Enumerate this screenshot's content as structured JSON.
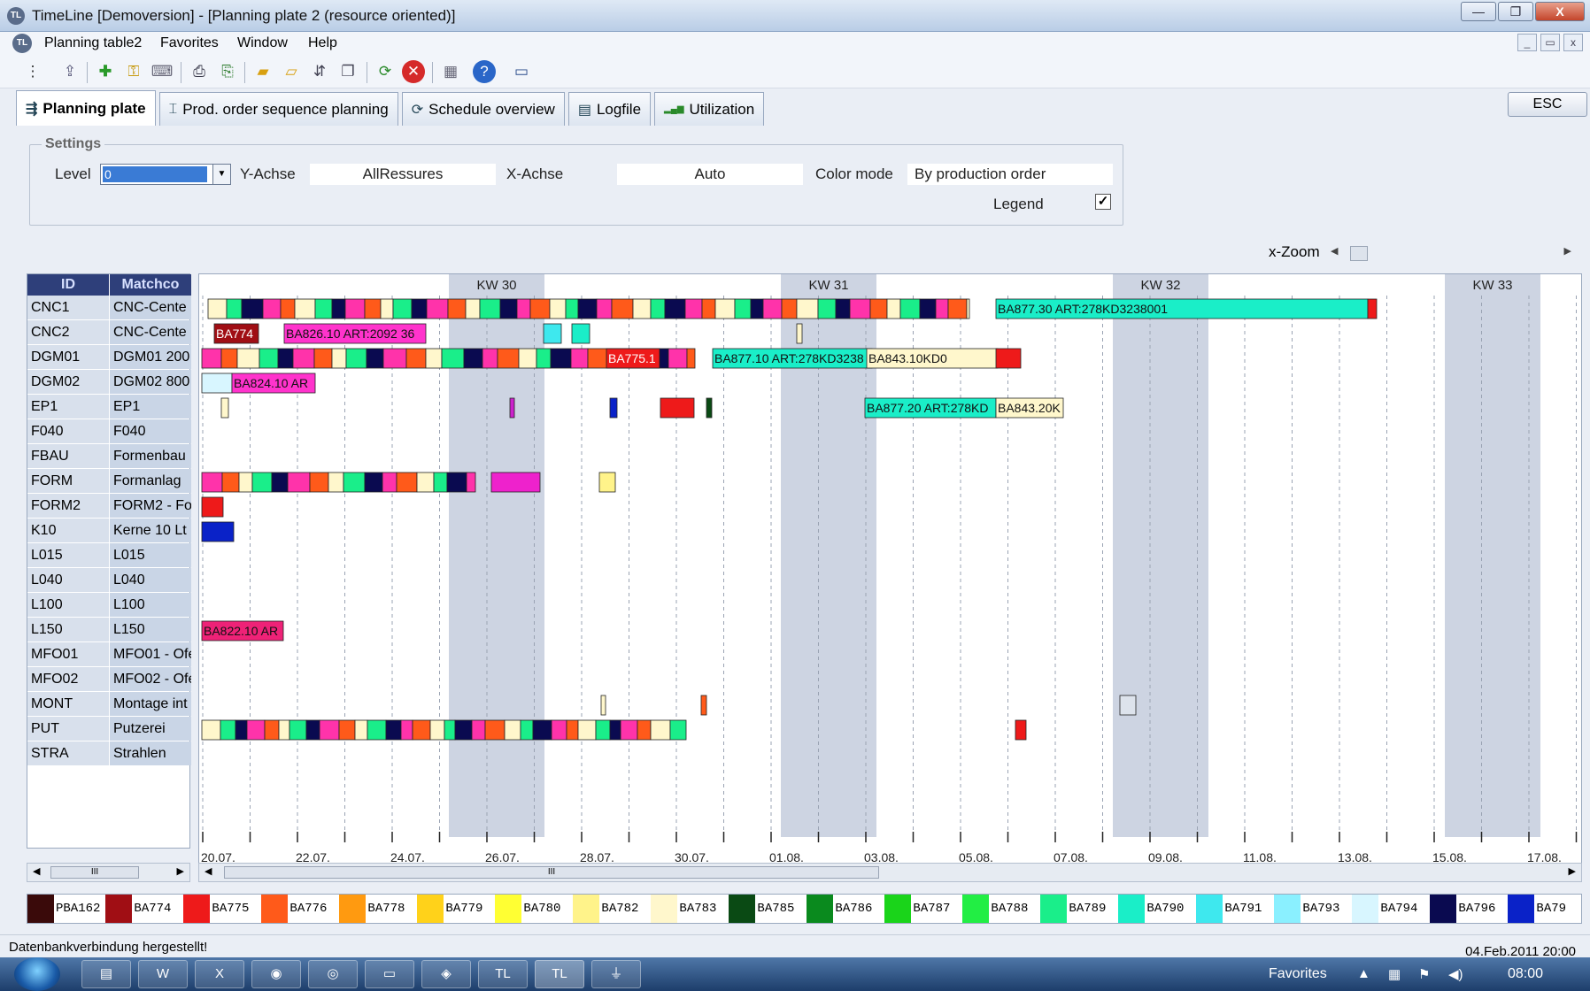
{
  "window": {
    "title": "TimeLine [Demoversion] - [Planning plate 2 (resource oriented)]",
    "app_icon_text": "TL",
    "minimize": "—",
    "maximize": "❐",
    "close": "X"
  },
  "menu": {
    "items": [
      "Planning table2",
      "Favorites",
      "Window",
      "Help"
    ],
    "mdi": [
      "_",
      "▭",
      "x"
    ]
  },
  "tabs": [
    {
      "label": "Planning plate",
      "icon": "⇶"
    },
    {
      "label": "Prod. order sequence planning",
      "icon": "⌶"
    },
    {
      "label": "Schedule overview",
      "icon": "⟳"
    },
    {
      "label": "Logfile",
      "icon": "▤"
    },
    {
      "label": "Utilization",
      "icon": "▂▄▆"
    }
  ],
  "esc_label": "ESC",
  "settings": {
    "legend": "Settings",
    "level_label": "Level",
    "level_value": "0",
    "y_label": "Y-Achse",
    "y_value": "AllRessures",
    "x_label": "X-Achse",
    "x_value": "Auto",
    "color_label": "Color mode",
    "color_value": "By production order",
    "legend_label": "Legend",
    "legend_checked": "✓"
  },
  "zoom_label": "x-Zoom",
  "grid": {
    "headers": [
      "ID",
      "Matchco"
    ],
    "rows": [
      {
        "id": "CNC1",
        "match": "CNC-Cente"
      },
      {
        "id": "CNC2",
        "match": "CNC-Cente"
      },
      {
        "id": "DGM01",
        "match": "DGM01 200"
      },
      {
        "id": "DGM02",
        "match": "DGM02 800"
      },
      {
        "id": "EP1",
        "match": "EP1"
      },
      {
        "id": "F040",
        "match": "F040"
      },
      {
        "id": "FBAU",
        "match": "Formenbau"
      },
      {
        "id": "FORM",
        "match": "Formanlag"
      },
      {
        "id": "FORM2",
        "match": "FORM2 - Fo"
      },
      {
        "id": "K10",
        "match": "Kerne 10 Lt"
      },
      {
        "id": "L015",
        "match": "L015"
      },
      {
        "id": "L040",
        "match": "L040"
      },
      {
        "id": "L100",
        "match": "L100"
      },
      {
        "id": "L150",
        "match": "L150"
      },
      {
        "id": "MFO01",
        "match": "MFO01 - Ofe"
      },
      {
        "id": "MFO02",
        "match": "MFO02 - Ofe"
      },
      {
        "id": "MONT",
        "match": "Montage int"
      },
      {
        "id": "PUT",
        "match": "Putzerei"
      },
      {
        "id": "STRA",
        "match": "Strahlen"
      }
    ],
    "scroll_thumb": "III"
  },
  "gantt": {
    "weeks": [
      "KW 30",
      "KW 31",
      "KW 32",
      "KW 33"
    ],
    "dates": [
      "20.07.",
      "22.07.",
      "24.07.",
      "26.07.",
      "28.07.",
      "30.07.",
      "01.08.",
      "03.08.",
      "05.08.",
      "07.08.",
      "09.08.",
      "11.08.",
      "13.08.",
      "15.08.",
      "17.08."
    ],
    "labels": {
      "cnc1_long": "BA877.30 ART:278KD3238001",
      "cnc2_a": "BA774",
      "cnc2_b": "BA826.10 ART:2092 36",
      "dgm01_long": "BA877.10 ART:278KD3238",
      "dgm01_b": "BA843.10KD0",
      "dgm01_c": "BA775.1",
      "dgm02": "BA824.10 AR",
      "ep1_a": "BA877.20 ART:278KD",
      "ep1_b": "BA843.20K",
      "l150": "BA822.10 AR"
    },
    "scroll_thumb": "III"
  },
  "legend_items": [
    {
      "label": "PBA162",
      "color": "#3a0a0a"
    },
    {
      "label": "BA774",
      "color": "#a00e14"
    },
    {
      "label": "BA775",
      "color": "#ee1a1a"
    },
    {
      "label": "BA776",
      "color": "#ff5a1a"
    },
    {
      "label": "BA778",
      "color": "#ff9a10"
    },
    {
      "label": "BA779",
      "color": "#ffd21a"
    },
    {
      "label": "BA780",
      "color": "#ffff33"
    },
    {
      "label": "BA782",
      "color": "#fff38a"
    },
    {
      "label": "BA783",
      "color": "#fff7cc"
    },
    {
      "label": "BA785",
      "color": "#0a4a14"
    },
    {
      "label": "BA786",
      "color": "#0a8a1e"
    },
    {
      "label": "BA787",
      "color": "#1ad41a"
    },
    {
      "label": "BA788",
      "color": "#22ee44"
    },
    {
      "label": "BA789",
      "color": "#1aee8a"
    },
    {
      "label": "BA790",
      "color": "#1aeec8"
    },
    {
      "label": "BA791",
      "color": "#3ee8ee"
    },
    {
      "label": "BA793",
      "color": "#8af0ff"
    },
    {
      "label": "BA794",
      "color": "#d8f6ff"
    },
    {
      "label": "BA796",
      "color": "#0a0a50"
    },
    {
      "label": "BA79",
      "color": "#0a22c8"
    }
  ],
  "status": {
    "message": "Datenbankverbindung hergestellt!",
    "datetime": "04.Feb.2011 20:00"
  },
  "taskbar": {
    "favorites": "Favorites",
    "time": "08:00"
  }
}
